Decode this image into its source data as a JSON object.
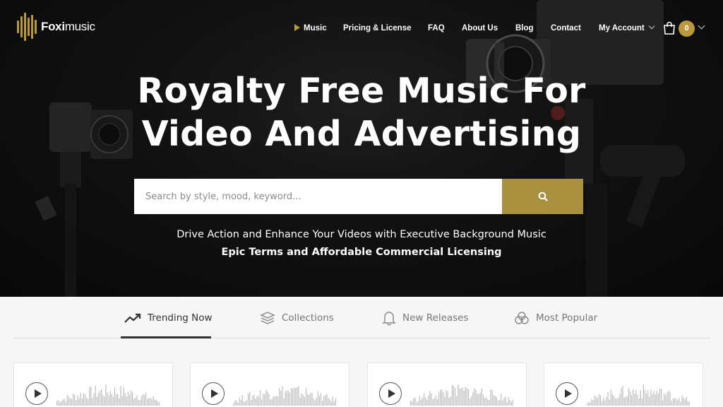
{
  "brand": {
    "logo_bold": "Foxi",
    "logo_light": "music"
  },
  "nav": {
    "items": [
      {
        "label": "Music",
        "active": true
      },
      {
        "label": "Pricing & License"
      },
      {
        "label": "FAQ"
      },
      {
        "label": "About Us"
      },
      {
        "label": "Blog"
      },
      {
        "label": "Contact"
      },
      {
        "label": "My Account"
      }
    ],
    "cart_count": "0"
  },
  "hero": {
    "headline_line1": "Royalty Free Music For",
    "headline_line2": "Video And Advertising",
    "search_placeholder": "Search by style, mood, keyword...",
    "subtitle": "Drive Action and Enhance Your Videos with Executive Background Music",
    "subtitle_bold": "Epic Terms and Affordable Commercial Licensing"
  },
  "tabs": [
    {
      "label": "Trending Now",
      "icon": "trending-up-icon",
      "active": true
    },
    {
      "label": "Collections",
      "icon": "layers-icon"
    },
    {
      "label": "New Releases",
      "icon": "bell-icon"
    },
    {
      "label": "Most Popular",
      "icon": "circles-icon"
    }
  ],
  "colors": {
    "accent": "#b89a3c",
    "search_button": "#a9913f",
    "hero_bg": "#111111"
  }
}
